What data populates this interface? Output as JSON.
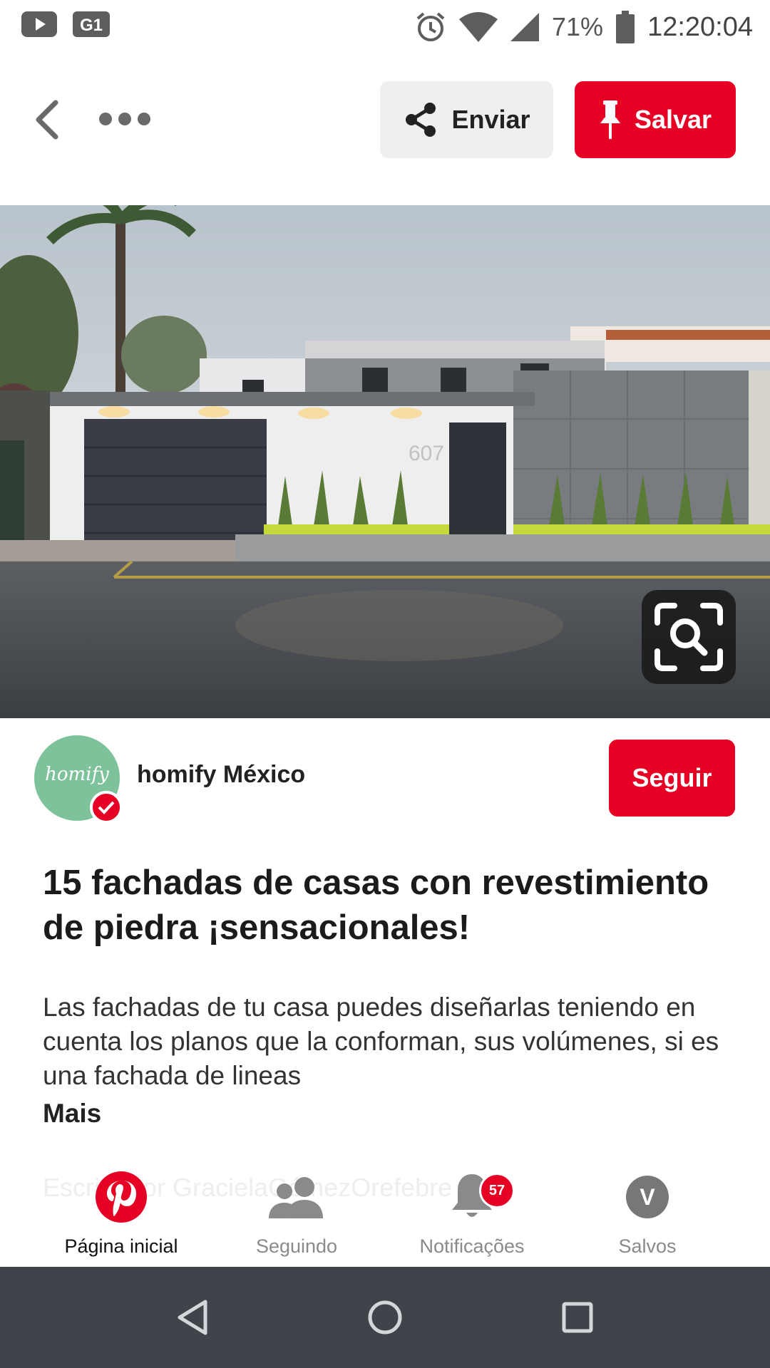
{
  "status_bar": {
    "battery": "71%",
    "time": "12:20:04",
    "icons": [
      "youtube-icon",
      "g1-icon",
      "alarm-icon",
      "wifi-icon",
      "signal-icon",
      "battery-icon"
    ]
  },
  "top_bar": {
    "enviar_label": "Enviar",
    "salvar_label": "Salvar",
    "icons": [
      "back-icon",
      "more-icon",
      "share-icon",
      "pin-icon"
    ]
  },
  "image": {
    "house_number": "607",
    "lens_icon": "visual-search-icon"
  },
  "profile": {
    "avatar_text": "homify",
    "name": "homify México",
    "follow_label": "Seguir"
  },
  "pin": {
    "title": "15 fachadas de casas con revestimiento de piedra ¡sensacionales!",
    "description": "Las fachadas de tu casa puedes diseñarlas teniendo en cuenta los planos que la conforman, sus volúmenes, si es una fachada de lineas",
    "more_label": "Mais",
    "faded_comment": "Escrito por GracielaGómezOrefebre"
  },
  "tabs": [
    {
      "label": "Página inicial",
      "icon": "pinterest-icon",
      "active": true
    },
    {
      "label": "Seguindo",
      "icon": "people-icon"
    },
    {
      "label": "Notificações",
      "icon": "bell-icon",
      "badge": "57"
    },
    {
      "label": "Salvos",
      "icon": "profile-avatar",
      "avatar_letter": "V"
    }
  ],
  "colors": {
    "brand_red": "#e60023",
    "nav_bar": "#3f434a"
  }
}
